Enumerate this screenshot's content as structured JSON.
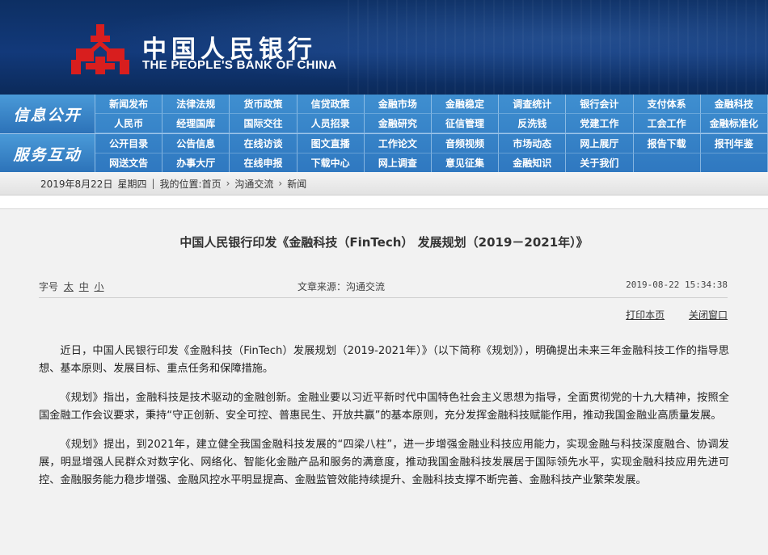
{
  "header": {
    "bank_name_cn": "中国人民银行",
    "bank_name_en": "THE PEOPLE'S BANK OF CHINA",
    "logo_icon": "pboc-logo-icon",
    "brand_color": "#0d2f63",
    "logo_color": "#d81e1e"
  },
  "nav": {
    "sections": [
      {
        "label": "信息公开",
        "items": [
          "新闻发布",
          "法律法规",
          "货币政策",
          "信贷政策",
          "金融市场",
          "金融稳定",
          "调查统计",
          "银行会计",
          "支付体系",
          "金融科技",
          "人民币",
          "经理国库",
          "国际交往",
          "人员招录",
          "金融研究",
          "征信管理",
          "反洗钱",
          "党建工作",
          "工会工作",
          "金融标准化"
        ]
      },
      {
        "label": "服务互动",
        "items": [
          "公开目录",
          "公告信息",
          "在线访谈",
          "图文直播",
          "工作论文",
          "音频视频",
          "市场动态",
          "网上展厅",
          "报告下载",
          "报刊年鉴",
          "网送文告",
          "办事大厅",
          "在线申报",
          "下载中心",
          "网上调查",
          "意见征集",
          "金融知识",
          "关于我们",
          "",
          ""
        ]
      }
    ]
  },
  "breadcrumb": {
    "date": "2019年8月22日",
    "weekday": "星期四",
    "location_label": "我的位置:",
    "items": [
      "首页",
      "沟通交流",
      "新闻"
    ]
  },
  "article": {
    "title": "中国人民银行印发《金融科技（FinTech） 发展规划（2019－2021年）》",
    "font_size_label": "字号",
    "font_sizes": [
      "太",
      "中",
      "小"
    ],
    "source": "文章来源：沟通交流",
    "datetime": "2019-08-22 15:34:38",
    "print_link": "打印本页",
    "close_link": "关闭窗口",
    "paragraphs": [
      "近日，中国人民银行印发《金融科技（FinTech）发展规划（2019-2021年）》（以下简称《规划》），明确提出未来三年金融科技工作的指导思想、基本原则、发展目标、重点任务和保障措施。",
      "《规划》指出，金融科技是技术驱动的金融创新。金融业要以习近平新时代中国特色社会主义思想为指导，全面贯彻党的十九大精神，按照全国金融工作会议要求，秉持“守正创新、安全可控、普惠民生、开放共赢”的基本原则，充分发挥金融科技赋能作用，推动我国金融业高质量发展。",
      "《规划》提出，到2021年，建立健全我国金融科技发展的“四梁八柱”，进一步增强金融业科技应用能力，实现金融与科技深度融合、协调发展，明显增强人民群众对数字化、网络化、智能化金融产品和服务的满意度，推动我国金融科技发展居于国际领先水平，实现金融科技应用先进可控、金融服务能力稳步增强、金融风控水平明显提高、金融监管效能持续提升、金融科技支撑不断完善、金融科技产业繁荣发展。"
    ]
  }
}
